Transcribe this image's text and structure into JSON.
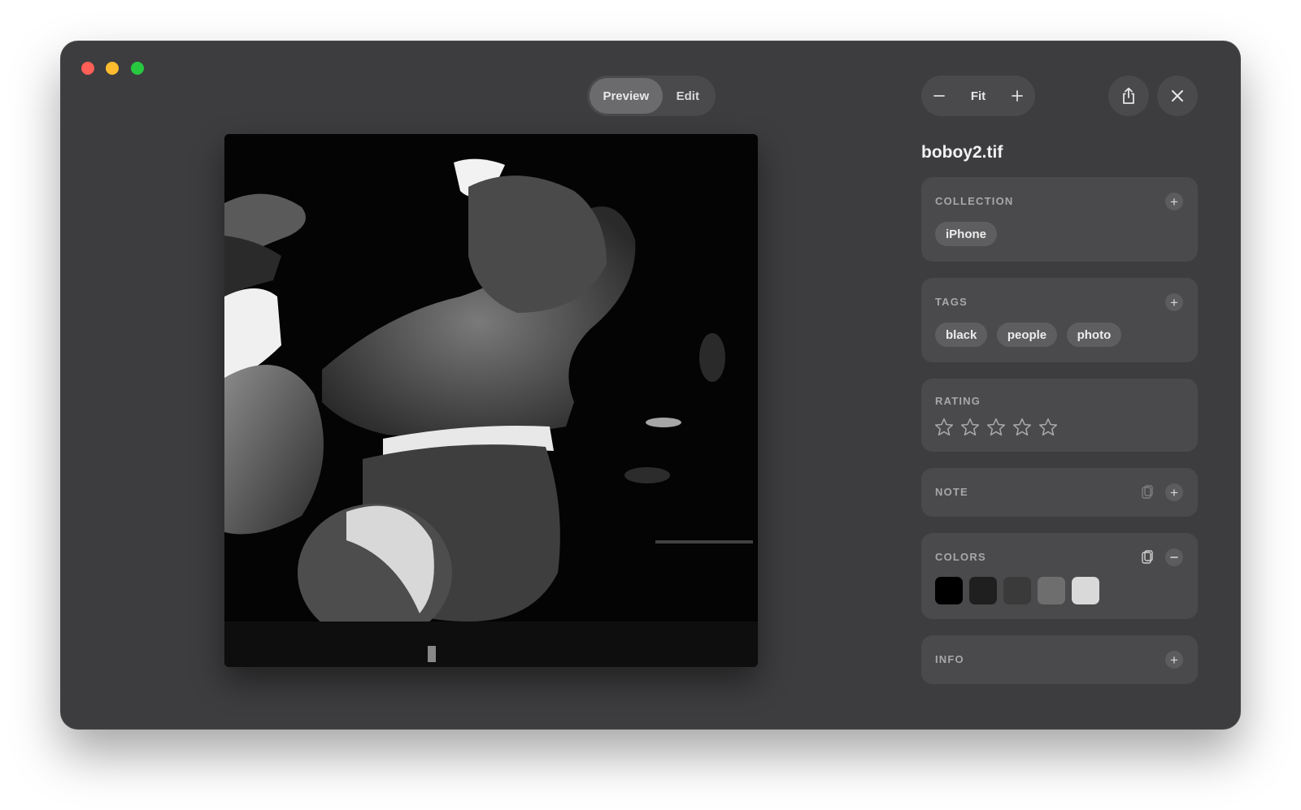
{
  "window": {
    "title_buttons": [
      "close",
      "minimize",
      "zoom"
    ]
  },
  "toolbar": {
    "mode_tabs": [
      {
        "label": "Preview",
        "selected": true
      },
      {
        "label": "Edit",
        "selected": false
      }
    ],
    "zoom": {
      "label": "Fit",
      "zoom_out_icon": "minus-icon",
      "zoom_in_icon": "plus-icon"
    },
    "share_icon": "share-icon",
    "close_icon": "close-icon"
  },
  "image": {
    "description_icon": "photo-viewer"
  },
  "inspector": {
    "filename": "boboy2.tif",
    "collection": {
      "title": "COLLECTION",
      "items": [
        "iPhone"
      ]
    },
    "tags": {
      "title": "TAGS",
      "items": [
        "black",
        "people",
        "photo"
      ]
    },
    "rating": {
      "title": "RATING",
      "value": 0,
      "max": 5
    },
    "note": {
      "title": "NOTE"
    },
    "colors": {
      "title": "COLORS",
      "swatches": [
        "#000000",
        "#1f1f1f",
        "#3a3a3a",
        "#6e6e6e",
        "#d9d9d9"
      ]
    },
    "info": {
      "title": "INFO"
    }
  },
  "theme": {
    "window_bg": "#3d3d3f",
    "card_bg": "#4a4a4c",
    "accent_text": "#f2f2f2"
  }
}
